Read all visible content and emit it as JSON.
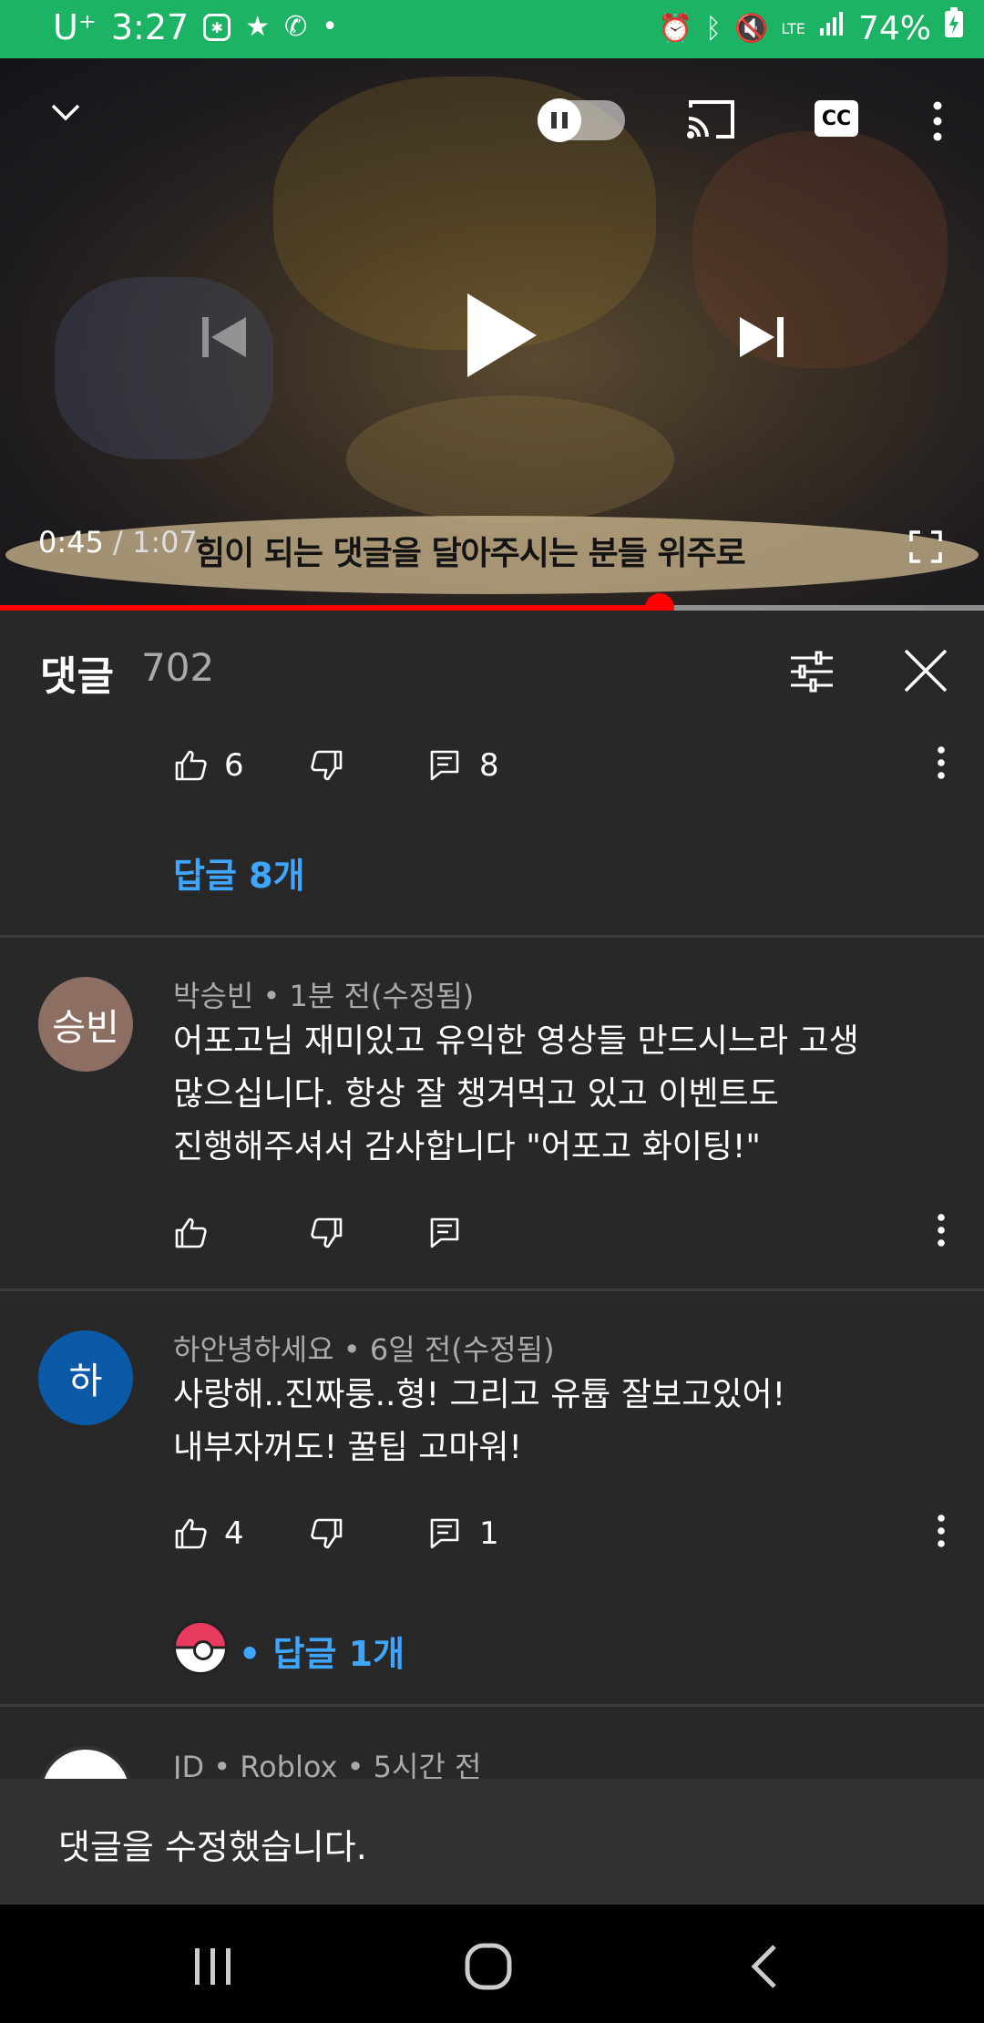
{
  "status_bar": {
    "carrier": "U⁺",
    "time": "3:27",
    "battery": "74%",
    "network": "LTE"
  },
  "player": {
    "subtitle": "힘이 되는 댓글을 달아주시는 분들 위주로",
    "current_time": "0:45",
    "separator": " / ",
    "duration": "1:07",
    "progress": 0.67,
    "cc_label": "CC"
  },
  "comments": {
    "title": "댓글",
    "count": "702",
    "top_actions": {
      "likes": "6",
      "replies": "8"
    },
    "top_replies_link": "답글 8개",
    "items": [
      {
        "avatar_text": "승빈",
        "avatar_color": "#8d6e63",
        "meta": "박승빈 • 1분 전(수정됨)",
        "body_lines": [
          "어포고님 재미있고 유익한 영상들 만드시느라 고생",
          "많으십니다. 항상 잘 챙겨먹고 있고 이벤트도",
          "진행해주셔서 감사합니다 \"어포고 화이팅!\""
        ]
      },
      {
        "avatar_text": "하",
        "avatar_color": "#0b5aa8",
        "meta": "하안녕하세요 • 6일 전(수정됨)",
        "body_lines": [
          "사랑해..진짜룽..형! 그리고 유튭 잘보고있어!",
          "내부자꺼도! 꿀팁 고마워!"
        ],
        "likes": "4",
        "replies": "1",
        "replies_link": "• 답글 1개"
      },
      {
        "meta": "JD • Roblox • 5시간 전"
      }
    ]
  },
  "snackbar": {
    "message": "댓글을 수정했습니다."
  },
  "colors": {
    "status_bar": "#1db364",
    "progress": "#ff0000",
    "link": "#3ea6ff",
    "panel": "#282828"
  }
}
